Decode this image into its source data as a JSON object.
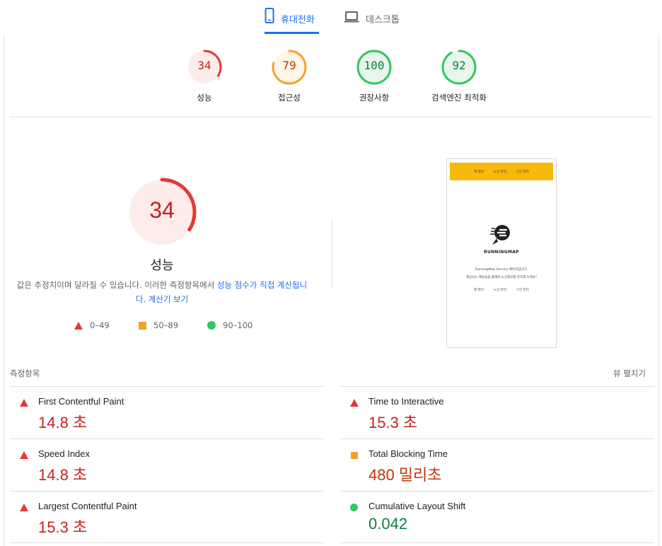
{
  "tabs": [
    {
      "label": "휴대전화",
      "icon": "mobile-phone-icon",
      "active": true
    },
    {
      "label": "데스크톱",
      "icon": "laptop-icon",
      "active": false
    }
  ],
  "summary": [
    {
      "score": "34",
      "label": "성능",
      "value": 0.34,
      "status": "fail",
      "color": "#e53935",
      "text_color": "#c5221f",
      "bg": "#fdecea"
    },
    {
      "score": "79",
      "label": "접근성",
      "value": 0.79,
      "status": "average",
      "color": "#f4a22c",
      "text_color": "#c33300",
      "bg": "#fef6e7"
    },
    {
      "score": "100",
      "label": "권장사항",
      "value": 1.0,
      "status": "pass",
      "color": "#32c75e",
      "text_color": "#0b8043",
      "bg": "#e8f6ec"
    },
    {
      "score": "92",
      "label": "검색엔진 최적화",
      "value": 0.92,
      "status": "pass",
      "color": "#32c75e",
      "text_color": "#0b8043",
      "bg": "#e8f6ec"
    }
  ],
  "performance": {
    "score": "34",
    "value": 0.34,
    "title": "성능",
    "desc_plain": "값은 추정치이며 달라질 수 있습니다. 이러한 측정항목에서 ",
    "desc_link1": "성능 점수가 직접 계산됩니",
    "desc_link1b": "다.",
    "desc_link2": "계산기 보기",
    "legend": [
      {
        "shape": "triangle",
        "range": "0–49"
      },
      {
        "shape": "square",
        "range": "50–89"
      },
      {
        "shape": "circle",
        "range": "90–100"
      }
    ]
  },
  "screenshot": {
    "nav": [
      "책 관리",
      "노선 관리",
      "구간 관리"
    ],
    "brand": "RUNNINGMAP",
    "line1": "RunningMap Service 페이지입니다.",
    "line2": "제공되는 메뉴들을 통해서 노선정보를 관리해 보세요!",
    "links": [
      "책 관리",
      "노선 관리",
      "구간 관리"
    ],
    "bar_color": "#f7b90c"
  },
  "metrics": {
    "heading": "측정항목",
    "expand": "뷰 펼치기",
    "items": [
      {
        "label": "First Contentful Paint",
        "value": "14.8 초",
        "status": "fail"
      },
      {
        "label": "Time to Interactive",
        "value": "15.3 초",
        "status": "fail"
      },
      {
        "label": "Speed Index",
        "value": "14.8 초",
        "status": "fail"
      },
      {
        "label": "Total Blocking Time",
        "value": "480 밀리초",
        "status": "average"
      },
      {
        "label": "Largest Contentful Paint",
        "value": "15.3 초",
        "status": "fail"
      },
      {
        "label": "Cumulative Layout Shift",
        "value": "0.042",
        "status": "pass"
      }
    ]
  }
}
